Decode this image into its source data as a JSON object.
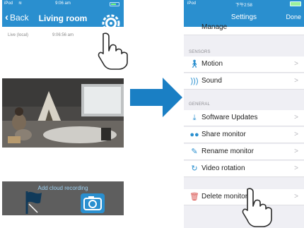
{
  "left_screen": {
    "status": {
      "carrier": "iPod",
      "time": "9:06 am"
    },
    "nav": {
      "back_label": "Back",
      "title": "Living room"
    },
    "info": {
      "label": "Live (local)",
      "timestamp": "9:06:56 am"
    },
    "cloud": {
      "label": "Add cloud recording"
    }
  },
  "right_screen": {
    "status": {
      "carrier": "iPod",
      "time": "下午2:58"
    },
    "nav": {
      "title": "Settings",
      "done_label": "Done"
    },
    "partial_item": "Manage",
    "sections": {
      "sensors": "SENSORS",
      "general": "GENERAL"
    },
    "sensors_items": [
      {
        "label": "Motion",
        "icon": "motion-icon"
      },
      {
        "label": "Sound",
        "icon": "sound-icon"
      }
    ],
    "general_items": [
      {
        "label": "Software Updates",
        "icon": "download-icon"
      },
      {
        "label": "Share monitor",
        "icon": "people-icon"
      },
      {
        "label": "Rename monitor",
        "icon": "pencil-icon"
      },
      {
        "label": "Video rotation",
        "icon": "rotate-icon"
      }
    ],
    "delete_item": {
      "label": "Delete monitor",
      "icon": "trash-icon"
    },
    "chevron": ">"
  },
  "colors": {
    "accent": "#2a8fcf",
    "delete": "#d9534f",
    "group_bg": "#efeff4"
  }
}
